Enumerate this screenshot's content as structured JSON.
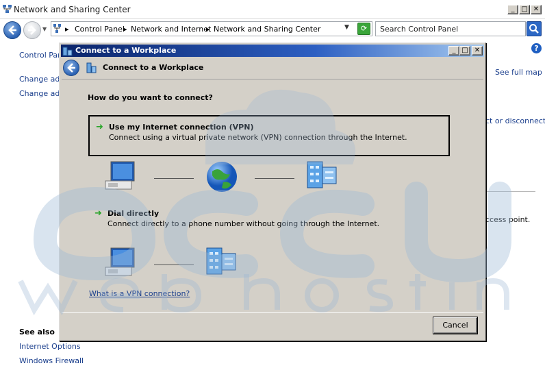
{
  "parent": {
    "title": "Network and Sharing Center",
    "breadcrumb": [
      "Control Panel",
      "Network and Internet",
      "Network and Sharing Center"
    ],
    "search_placeholder": "Search Control Panel",
    "sidebar": {
      "control_panel_home": "Control Pane",
      "change_adapter": "Change ada",
      "change_advanced": "Change adv",
      "see_also_heading": "See also",
      "see_also_items": [
        "Internet Options",
        "Windows Firewall"
      ]
    },
    "right_column": {
      "see_full_map": "See full map",
      "connect_disconnect": "ct or disconnect",
      "access_point": "ccess point."
    }
  },
  "dialog": {
    "title": "Connect to a Workplace",
    "header_title": "Connect to a Workplace",
    "question": "How do you want to connect?",
    "options": [
      {
        "title": "Use my Internet connection (VPN)",
        "description": "Connect using a virtual private network (VPN) connection through the Internet."
      },
      {
        "title": "Dial directly",
        "description": "Connect directly to a phone number without going through the Internet."
      }
    ],
    "help_link": "What is a VPN connection?",
    "cancel_label": "Cancel"
  },
  "colors": {
    "link": "#1a3e8c",
    "dialog_face": "#d4d0c8",
    "titlebar_start": "#0a246a",
    "arrow_green": "#2aa52a",
    "watermark": "#c8d7e6"
  }
}
